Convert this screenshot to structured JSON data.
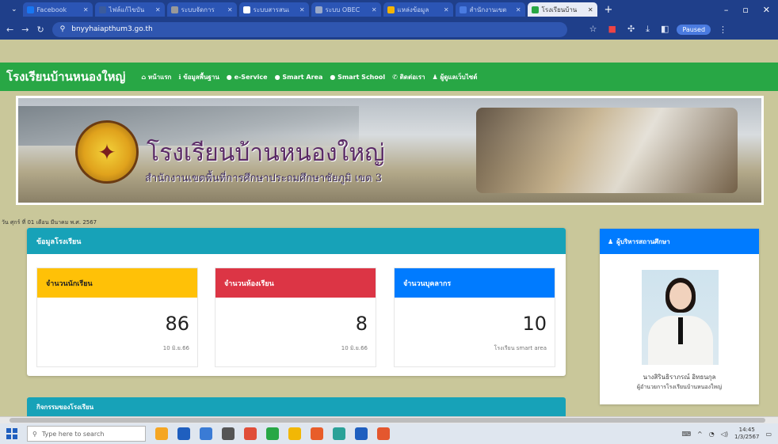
{
  "browser": {
    "tabs": [
      {
        "label": "Facebook",
        "color": "#1877f2"
      },
      {
        "label": "ไฟล์แก้ไขบัน",
        "color": "#3b5b9c"
      },
      {
        "label": "ระบบจัดการ",
        "color": "#999999"
      },
      {
        "label": "ระบบสารสนเ",
        "color": "#ffffff"
      },
      {
        "label": "ระบบ OBEC",
        "color": "#9aa9c8"
      },
      {
        "label": "แหล่งข้อมูล",
        "color": "#f5b400"
      },
      {
        "label": "สำนักงานเขต",
        "color": "#4a7be0"
      },
      {
        "label": "โรงเรียนบ้าน",
        "color": "#28a745",
        "active": true
      }
    ],
    "url": "bnyyhaiapthum3.go.th",
    "profile_label": "Paused"
  },
  "site": {
    "brand": "โรงเรียนบ้านหนองใหญ่",
    "nav": [
      {
        "label": "หน้าแรก",
        "icon": "home-icon"
      },
      {
        "label": "ข้อมูลพื้นฐาน",
        "icon": "info-icon"
      },
      {
        "label": "e-Service",
        "icon": "globe-icon"
      },
      {
        "label": "Smart Area",
        "icon": "globe-icon"
      },
      {
        "label": "Smart School",
        "icon": "globe-icon"
      },
      {
        "label": "ติดต่อเรา",
        "icon": "phone-icon"
      },
      {
        "label": "ผู้ดูแลเว็บไซต์",
        "icon": "user-icon"
      }
    ],
    "banner": {
      "title": "โรงเรียนบ้านหนองใหญ่",
      "subtitle": "สำนักงานเขตพื้นที่การศึกษาประถมศึกษาชัยภูมิ เขต 3"
    },
    "dateline": "วัน ศุกร์ ที่ 01 เดือน มีนาคม พ.ศ. 2567"
  },
  "stats": {
    "title": "ข้อมูลโรงเรียน",
    "cards": [
      {
        "label": "จำนวนนักเรียน",
        "value": "86",
        "note": "10 มิ.ย.66",
        "color": "#ffc107",
        "text_color": "#222222"
      },
      {
        "label": "จำนวนห้องเรียน",
        "value": "8",
        "note": "10 มิ.ย.66",
        "color": "#dc3545",
        "text_color": "#ffffff"
      },
      {
        "label": "จำนวนบุคลากร",
        "value": "10",
        "note": "โรงเรียน smart area",
        "color": "#007bff",
        "text_color": "#ffffff"
      }
    ]
  },
  "principal": {
    "title": "ผู้บริหารสถานศึกษา",
    "name": "นางสิรินธิราภรณ์ อิทธนกุล",
    "role": "ผู้อำนวยการโรงเรียนบ้านหนองใหญ่"
  },
  "activity": {
    "title": "กิจกรรมของโรงเรียน"
  },
  "taskbar": {
    "search_placeholder": "Type here to search",
    "time": "14:45",
    "date": "1/3/2567"
  }
}
